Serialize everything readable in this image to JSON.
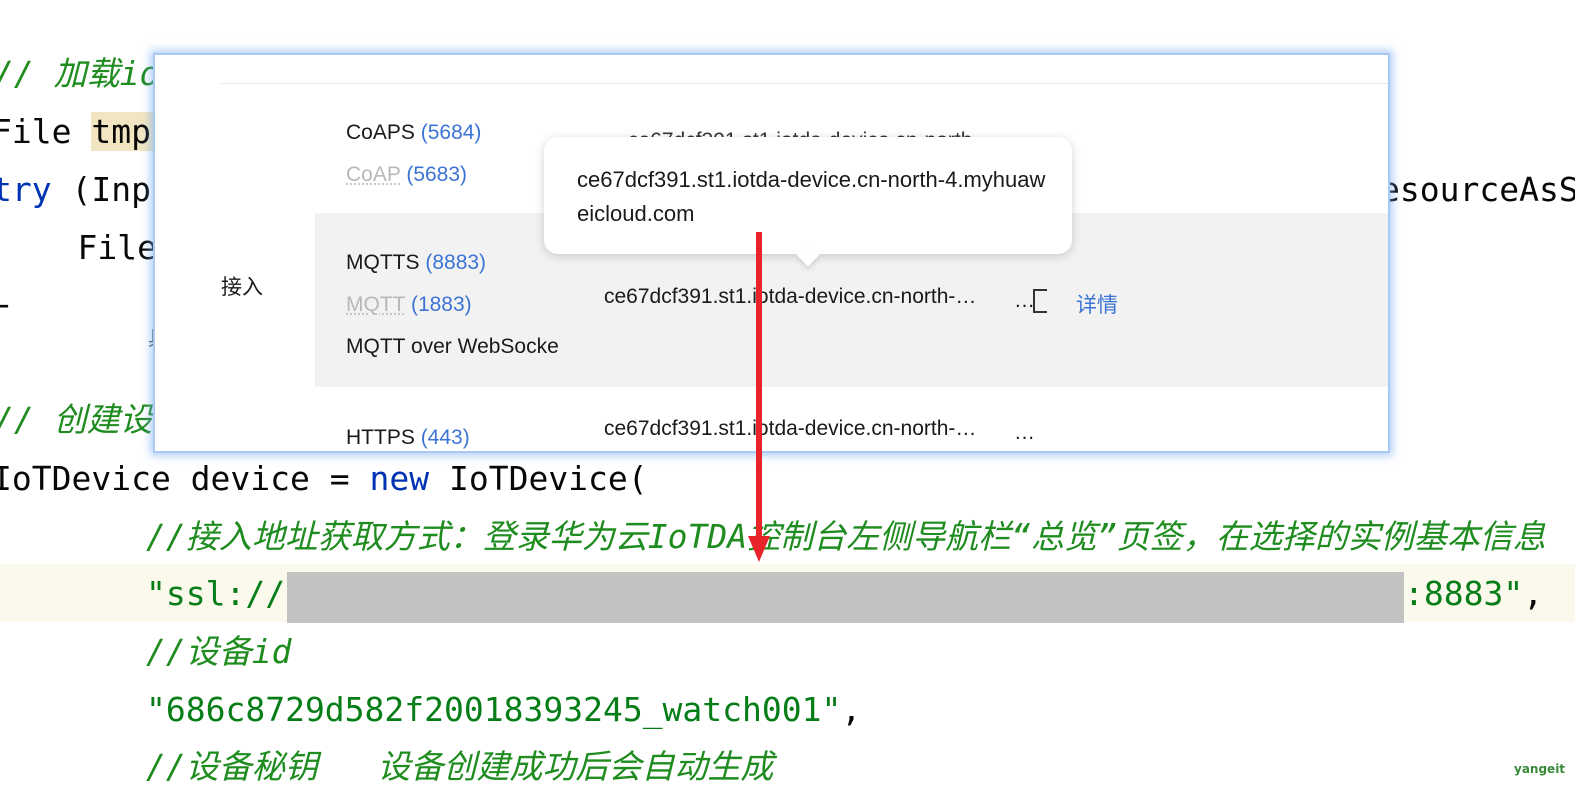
{
  "editor": {
    "lines": [
      {
        "cm": "// 加载io"
      },
      {
        "type": "File",
        "var": "tmp("
      },
      {
        "kw": "try",
        "rest": " (Inpu",
        "right": "esourceAsS"
      },
      {
        "text": "    Files"
      },
      {
        "text": "-"
      },
      {
        "cm": "// 创建设"
      },
      {
        "pre": "IoTDevice device = ",
        "kw": "new",
        "post": " IoTDevice("
      },
      {
        "cm": "//接入地址获取方式：登录华为云IoTDA控制台左侧导航栏“总览”页签，在选择的实例基本信息"
      },
      {
        "str_start": "\"ssl://",
        "str_end": ":8883\"",
        "tail": ","
      },
      {
        "cm": "//设备id"
      },
      {
        "str": "\"686c8729d582f20018393245_watch001\"",
        "tail": ","
      },
      {
        "cm": "//设备秘钥   设备创建成功后会自动生成"
      }
    ],
    "tiny_char": "具"
  },
  "panel": {
    "section_label": "接入",
    "rows": [
      {
        "proto": "CoAPS",
        "port": "(5684)",
        "host": "ce67dcf391.st1.iotda-device.cn-north-..."
      },
      {
        "proto": "CoAP",
        "port": "(5683)",
        "muted": true
      },
      {
        "proto": "MQTTS",
        "port": "(8883)",
        "host": "ce67dcf391.st1.iotda-device.cn-north-…",
        "detail": "详情"
      },
      {
        "proto": "MQTT",
        "port": "(1883)",
        "muted": true
      },
      {
        "proto": "MQTT over WebSocke",
        "port": ""
      },
      {
        "proto": "HTTPS",
        "port": "(443)",
        "host": "ce67dcf391.st1.iotda-device.cn-north-…"
      }
    ],
    "ellipsis": "…"
  },
  "tooltip": {
    "text": "ce67dcf391.st1.iotda-device.cn-north-4.myhuaweicloud.com"
  },
  "annotation": {
    "arrow_color": "#e8232a"
  },
  "watermark": "yangeit"
}
